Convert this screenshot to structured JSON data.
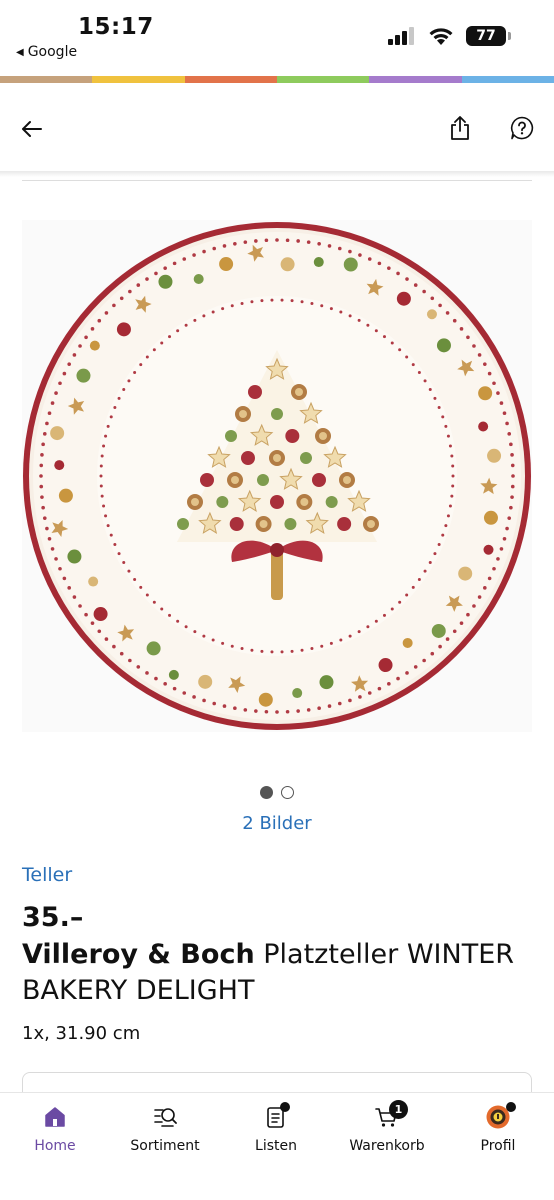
{
  "status_bar": {
    "time": "15:17",
    "back_app_label": "Google",
    "battery": "77",
    "icons": [
      "cellular-signal-icon",
      "wifi-icon",
      "battery-icon"
    ]
  },
  "brand_stripe_colors": [
    "#c6a27c",
    "#f0c23e",
    "#e2734a",
    "#8ecb5d",
    "#a57bcc",
    "#6cb2e6"
  ],
  "nav": {
    "icons": [
      "back-arrow-icon",
      "share-icon",
      "help-icon"
    ]
  },
  "product": {
    "image_count_label": "2 Bilder",
    "carousel": {
      "total": 2,
      "active_index": 0
    },
    "category": "Teller",
    "price": "35.–",
    "brand": "Villeroy & Boch",
    "name": "Platzteller WINTER BAKERY DELIGHT",
    "details": "1x, 31.90 cm"
  },
  "tabbar": {
    "active_color": "#6b4aa3",
    "tabs": [
      {
        "label": "Home",
        "icon": "home-icon",
        "active": true
      },
      {
        "label": "Sortiment",
        "icon": "assortment-search-icon",
        "active": false
      },
      {
        "label": "Listen",
        "icon": "list-icon",
        "active": false,
        "badge_dot": true
      },
      {
        "label": "Warenkorb",
        "icon": "cart-icon",
        "active": false,
        "badge_count": "1"
      },
      {
        "label": "Profil",
        "icon": "profile-avatar-icon",
        "active": false,
        "badge_dot": true
      }
    ]
  }
}
